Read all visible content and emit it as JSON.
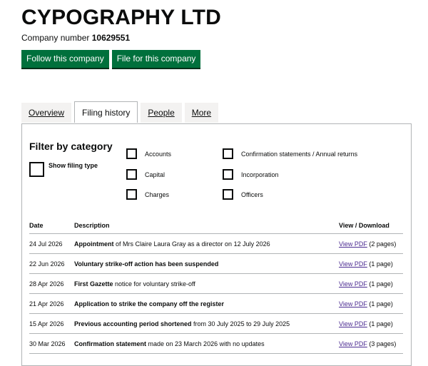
{
  "company": {
    "name": "CYPOGRAPHY LTD",
    "number_label": "Company number",
    "number": "10629551"
  },
  "buttons": {
    "follow": "Follow this company",
    "file": "File for this company"
  },
  "tabs": [
    {
      "label": "Overview",
      "active": false
    },
    {
      "label": "Filing history",
      "active": true
    },
    {
      "label": "People",
      "active": false
    },
    {
      "label": "More",
      "active": false
    }
  ],
  "filter": {
    "title": "Filter by category",
    "show_filing_type": "Show filing type",
    "categories": [
      "Accounts",
      "Capital",
      "Charges",
      "Confirmation statements / Annual returns",
      "Incorporation",
      "Officers"
    ]
  },
  "table": {
    "headers": {
      "date": "Date",
      "description": "Description",
      "view": "View / Download"
    },
    "rows": [
      {
        "date": "24 Jul 2026",
        "bold": "Appointment",
        "rest": " of Mrs Claire Laura Gray as a director on 12 July 2026",
        "link": "View PDF",
        "pages": " (2 pages)"
      },
      {
        "date": "22 Jun 2026",
        "bold": "Voluntary strike-off action has been suspended",
        "rest": "",
        "link": "View PDF",
        "pages": " (1 page)"
      },
      {
        "date": "28 Apr 2026",
        "bold": "First Gazette",
        "rest": " notice for voluntary strike-off",
        "link": "View PDF",
        "pages": " (1 page)"
      },
      {
        "date": "21 Apr 2026",
        "bold": "Application to strike the company off the register",
        "rest": "",
        "link": "View PDF",
        "pages": " (1 page)"
      },
      {
        "date": "15 Apr 2026",
        "bold": "Previous accounting period shortened",
        "rest": " from 30 July 2025 to 29 July 2025",
        "link": "View PDF",
        "pages": " (1 page)"
      },
      {
        "date": "30 Mar 2026",
        "bold": "Confirmation statement",
        "rest": " made on 23 March 2026 with no updates",
        "link": "View PDF",
        "pages": " (3 pages)"
      }
    ]
  },
  "colors": {
    "button_green": "#00703c",
    "link_purple": "#4c2c92",
    "border": "#b1b4b6",
    "tab_inactive": "#f3f2f1"
  }
}
